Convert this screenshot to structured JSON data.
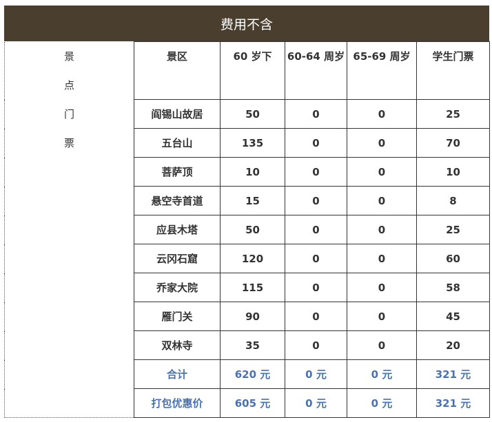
{
  "title": "费用不含",
  "category_label": [
    "景",
    "点",
    "门",
    "票"
  ],
  "headers": [
    "景区",
    "60 岁下",
    "60-64 周岁",
    "65-69 周岁",
    "学生门票"
  ],
  "rows": [
    {
      "name": "阎锡山故居",
      "under60": "50",
      "age60_64": "0",
      "age65_69": "0",
      "student": "25"
    },
    {
      "name": "五台山",
      "under60": "135",
      "age60_64": "0",
      "age65_69": "0",
      "student": "70"
    },
    {
      "name": "菩萨顶",
      "under60": "10",
      "age60_64": "0",
      "age65_69": "0",
      "student": "10"
    },
    {
      "name": "悬空寺首道",
      "under60": "15",
      "age60_64": "0",
      "age65_69": "0",
      "student": "8"
    },
    {
      "name": "应县木塔",
      "under60": "50",
      "age60_64": "0",
      "age65_69": "0",
      "student": "25"
    },
    {
      "name": "云冈石窟",
      "under60": "120",
      "age60_64": "0",
      "age65_69": "0",
      "student": "60"
    },
    {
      "name": "乔家大院",
      "under60": "115",
      "age60_64": "0",
      "age65_69": "0",
      "student": "58"
    },
    {
      "name": "雁门关",
      "under60": "90",
      "age60_64": "0",
      "age65_69": "0",
      "student": "45"
    },
    {
      "name": "双林寺",
      "under60": "35",
      "age60_64": "0",
      "age65_69": "0",
      "student": "20"
    }
  ],
  "total": {
    "name": "合计",
    "under60": "620 元",
    "age60_64": "0 元",
    "age65_69": "0 元",
    "student": "321 元"
  },
  "package": {
    "name": "打包优惠价",
    "under60": "605 元",
    "age60_64": "0 元",
    "age65_69": "0 元",
    "student": "321 元"
  },
  "colors": {
    "title_bg": "#4a3e2e",
    "summary_text": "#4a72b0"
  }
}
